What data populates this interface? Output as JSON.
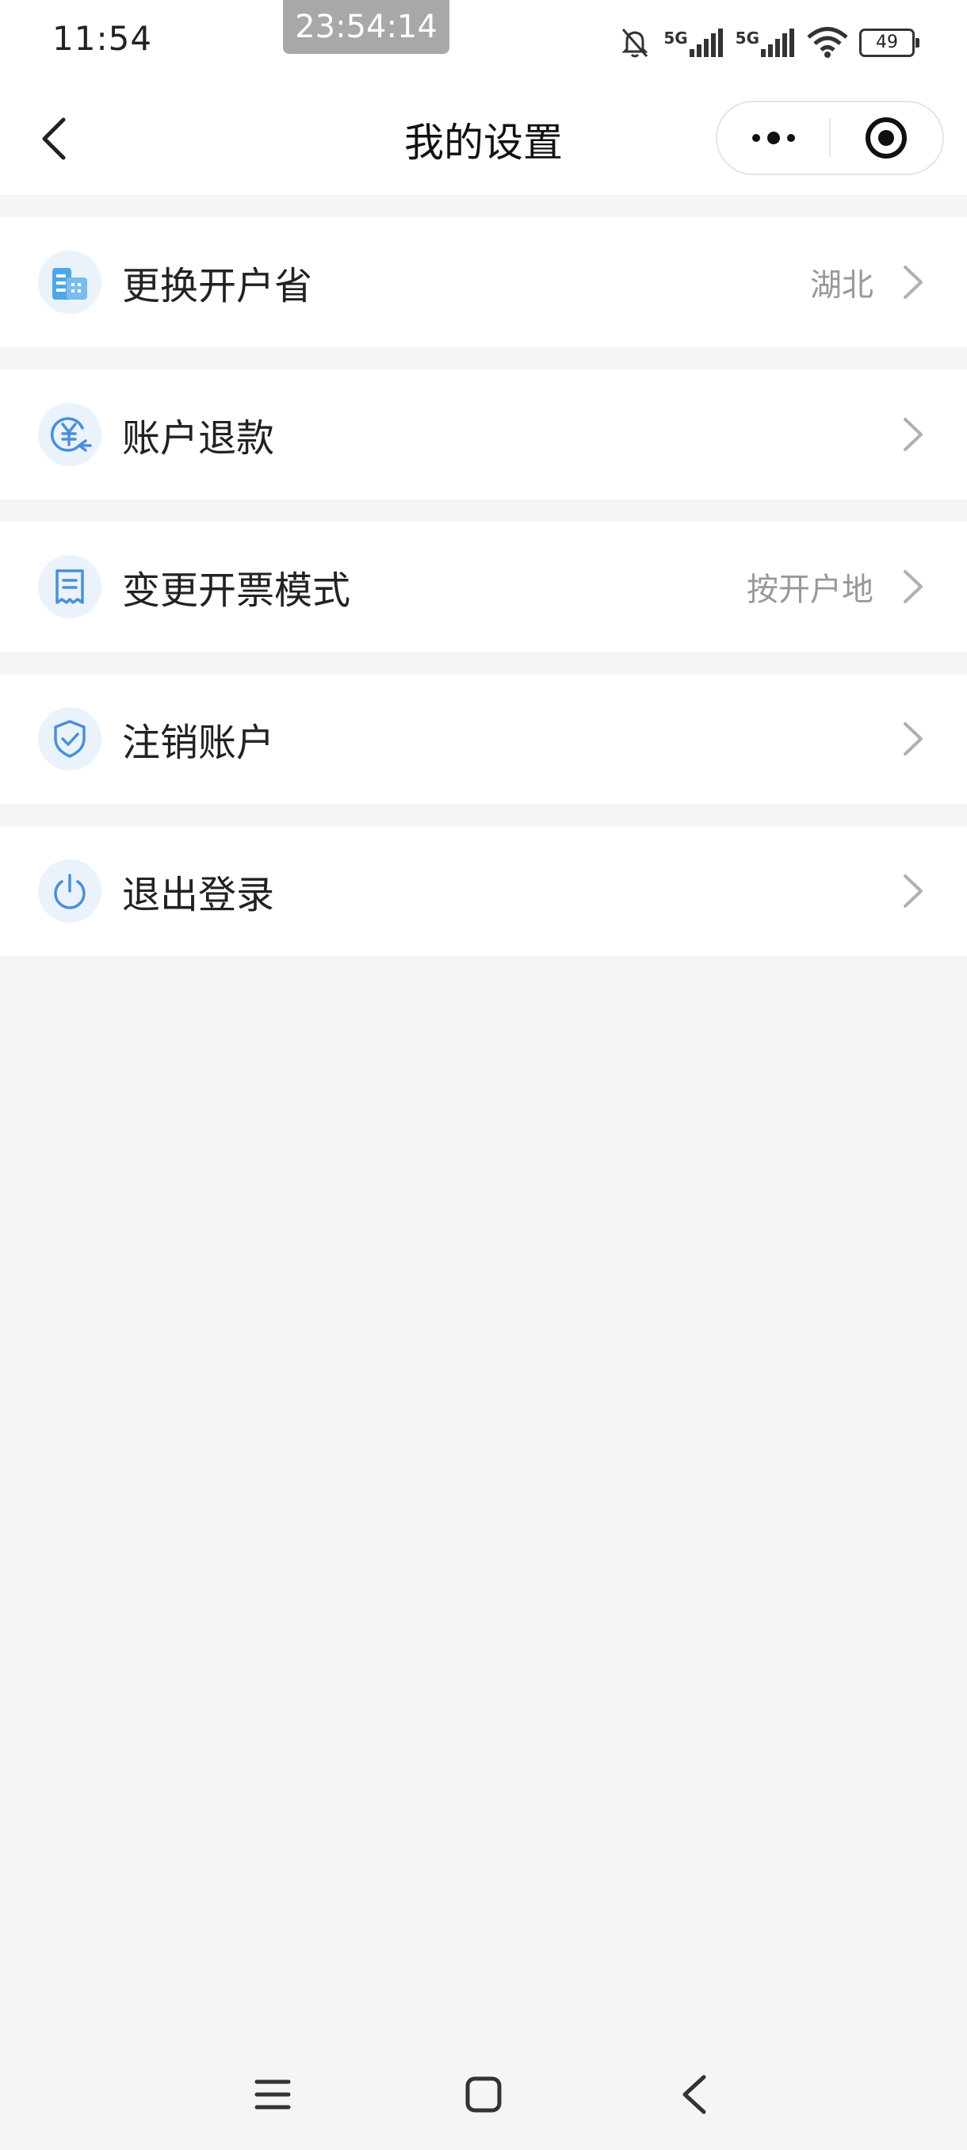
{
  "status_bar": {
    "time": "11:54",
    "recording_time": "23:54:14",
    "sim1_label": "5G",
    "sim2_label": "5G",
    "battery": "49"
  },
  "header": {
    "title": "我的设置",
    "back_icon": "chevron-left-icon",
    "more_icon": "more-dots-icon",
    "close_icon": "target-icon"
  },
  "settings": {
    "items": [
      {
        "label": "更换开户省",
        "value": "湖北",
        "icon": "building-icon"
      },
      {
        "label": "账户退款",
        "value": "",
        "icon": "refund-yuan-icon"
      },
      {
        "label": "变更开票模式",
        "value": "按开户地",
        "icon": "receipt-icon"
      },
      {
        "label": "注销账户",
        "value": "",
        "icon": "shield-check-icon"
      },
      {
        "label": "退出登录",
        "value": "",
        "icon": "power-icon"
      }
    ]
  },
  "colors": {
    "icon_blue": "#4a90d9",
    "icon_bg": "#eaf3fc",
    "chevron": "#b0b0b0",
    "value_text": "#999999"
  }
}
